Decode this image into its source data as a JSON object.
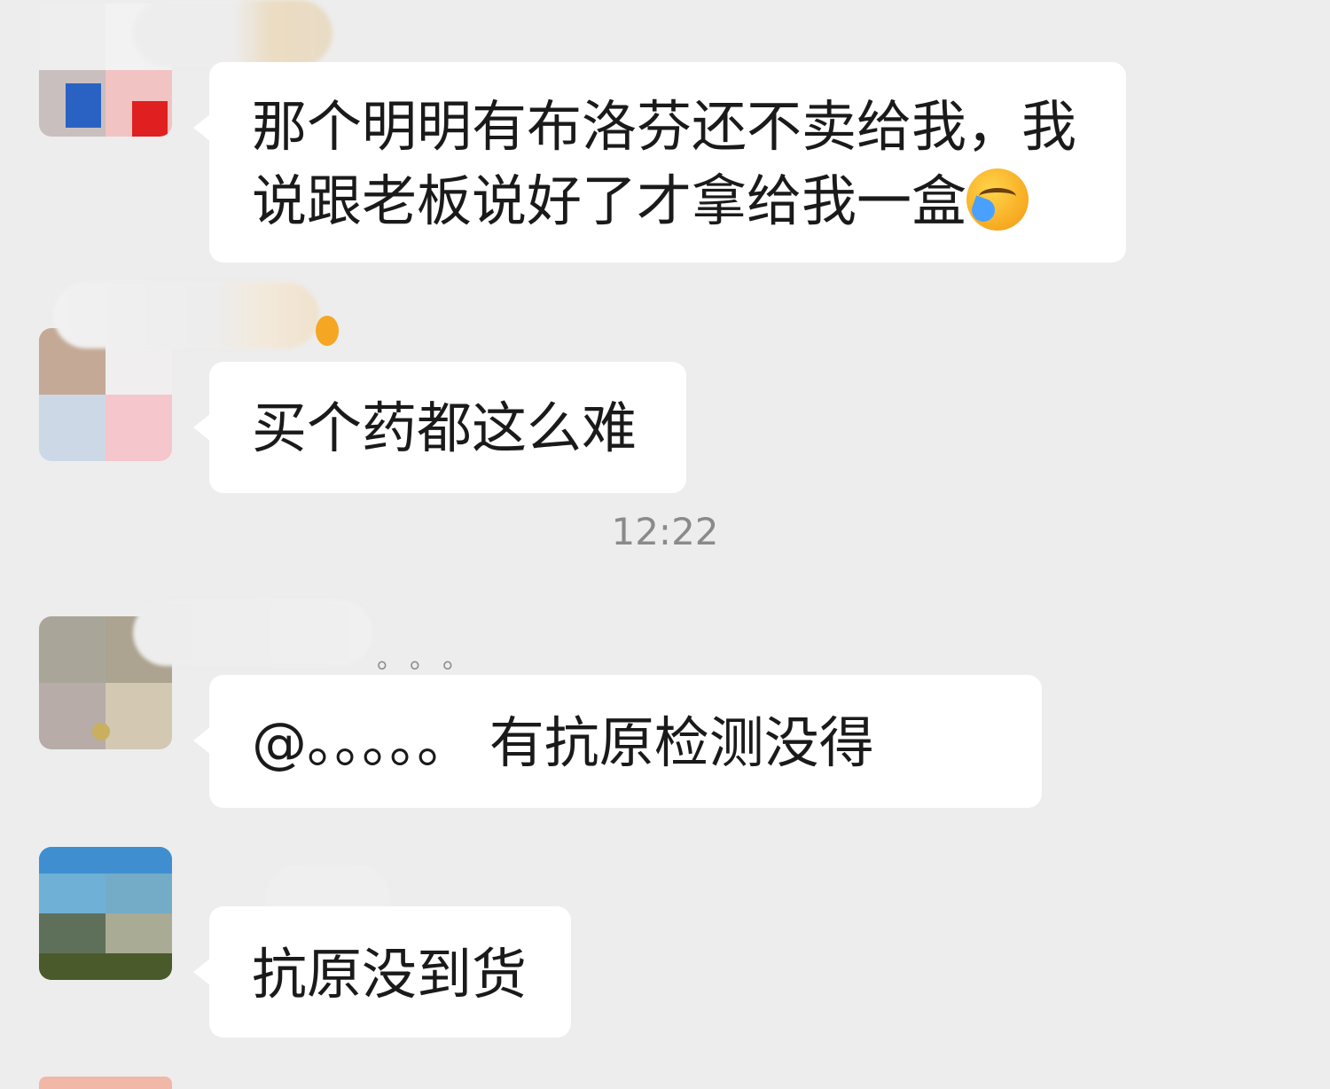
{
  "messages": [
    {
      "text": "那个明明有布洛芬还不卖给我，我说跟老板说好了才拿给我一盒",
      "emoji": "face-covering-eyes-crying-emoji"
    },
    {
      "text": "买个药都这么难"
    },
    {
      "text": "@。。。。。 有抗原检测没得"
    },
    {
      "text": "抗原没到货"
    }
  ],
  "timestamp": "12:22",
  "name_dots": "。。。",
  "colors": {
    "background": "#ededed",
    "bubble": "#ffffff",
    "timestamp": "#8a8a8a"
  }
}
